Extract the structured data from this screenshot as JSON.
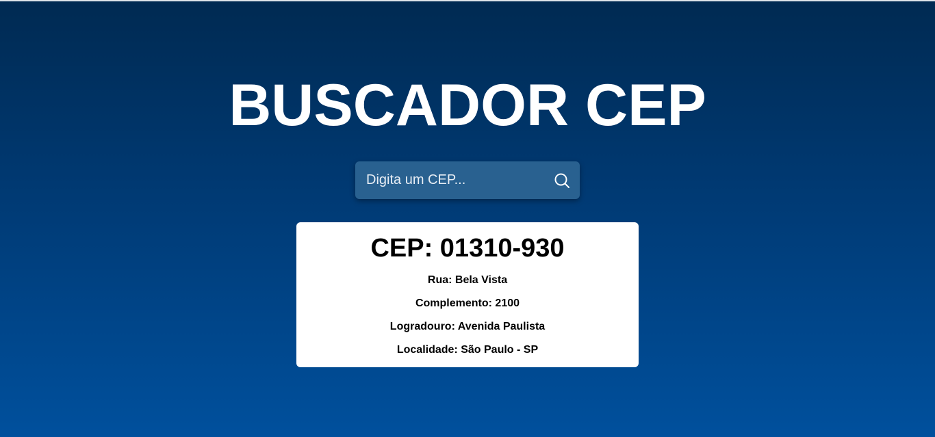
{
  "header": {
    "title": "BUSCADOR CEP"
  },
  "search": {
    "placeholder": "Digita um CEP...",
    "value": "",
    "button_icon": "search-icon"
  },
  "result": {
    "cep": "CEP: 01310-930",
    "rua": "Rua: Bela Vista",
    "complemento": "Complemento: 2100",
    "logradouro": "Logradouro: Avenida Paulista",
    "localidade": "Localidade: São Paulo - SP"
  },
  "colors": {
    "background_top": "#002a52",
    "background_bottom": "#00509d",
    "search_box": "#296190",
    "card": "#ffffff",
    "text_light": "#ffffff",
    "text_dark": "#000000"
  }
}
